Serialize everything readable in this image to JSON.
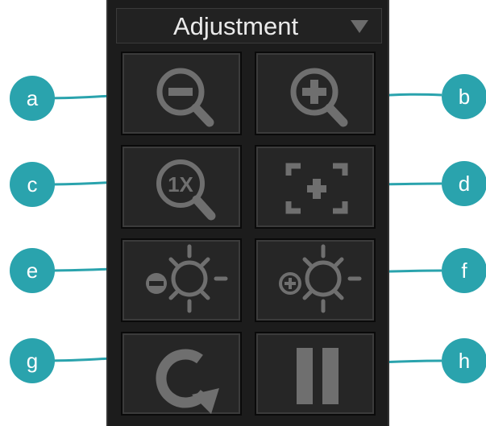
{
  "panel": {
    "title": "Adjustment",
    "dropdown_icon": "dropdown-triangle-icon"
  },
  "buttons": [
    {
      "id": "a",
      "icon": "zoom-out-icon"
    },
    {
      "id": "b",
      "icon": "zoom-in-icon"
    },
    {
      "id": "c",
      "icon": "zoom-1x-icon"
    },
    {
      "id": "d",
      "icon": "fit-to-screen-icon"
    },
    {
      "id": "e",
      "icon": "brightness-decrease-icon"
    },
    {
      "id": "f",
      "icon": "brightness-increase-icon"
    },
    {
      "id": "g",
      "icon": "reset-rotate-icon"
    },
    {
      "id": "h",
      "icon": "pause-icon"
    }
  ],
  "markers": [
    "a",
    "b",
    "c",
    "d",
    "e",
    "f",
    "g",
    "h"
  ],
  "colors": {
    "marker": "#2aa3ad",
    "icon": "#6f6f6f",
    "panel": "#1c1c1c"
  }
}
